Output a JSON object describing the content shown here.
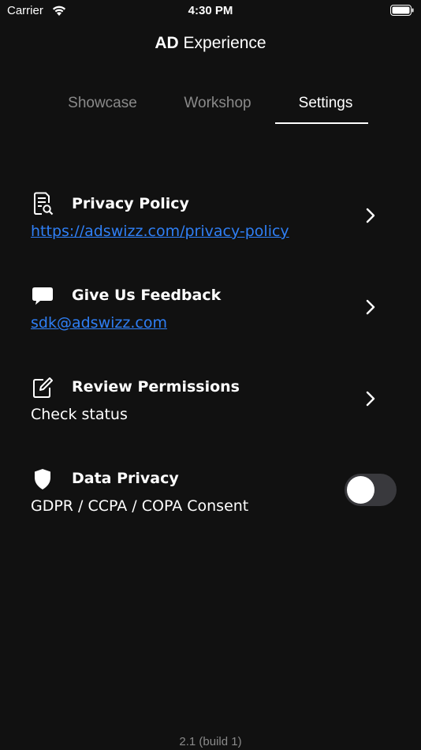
{
  "status_bar": {
    "carrier": "Carrier",
    "time": "4:30 PM"
  },
  "header": {
    "title_brand": "AD",
    "title_rest": " Experience"
  },
  "tabs": [
    {
      "label": "Showcase",
      "active": false
    },
    {
      "label": "Workshop",
      "active": false
    },
    {
      "label": "Settings",
      "active": true
    }
  ],
  "settings": {
    "privacy_policy": {
      "title": "Privacy Policy",
      "subtitle": "https://adswizz.com/privacy-policy",
      "icon": "document-search-icon"
    },
    "feedback": {
      "title": "Give Us Feedback",
      "subtitle": "sdk@adswizz.com",
      "icon": "chat-bubble-icon"
    },
    "permissions": {
      "title": "Review Permissions",
      "subtitle": "Check status",
      "icon": "edit-square-icon"
    },
    "data_privacy": {
      "title": "Data Privacy",
      "subtitle": "GDPR / CCPA / COPA Consent",
      "icon": "shield-icon",
      "toggle_on": false
    }
  },
  "footer": {
    "version": "2.1 (build 1)"
  },
  "colors": {
    "background": "#111111",
    "link": "#2f7ff5",
    "inactive_tab": "#8a8a8a",
    "toggle_off": "#39393d"
  }
}
